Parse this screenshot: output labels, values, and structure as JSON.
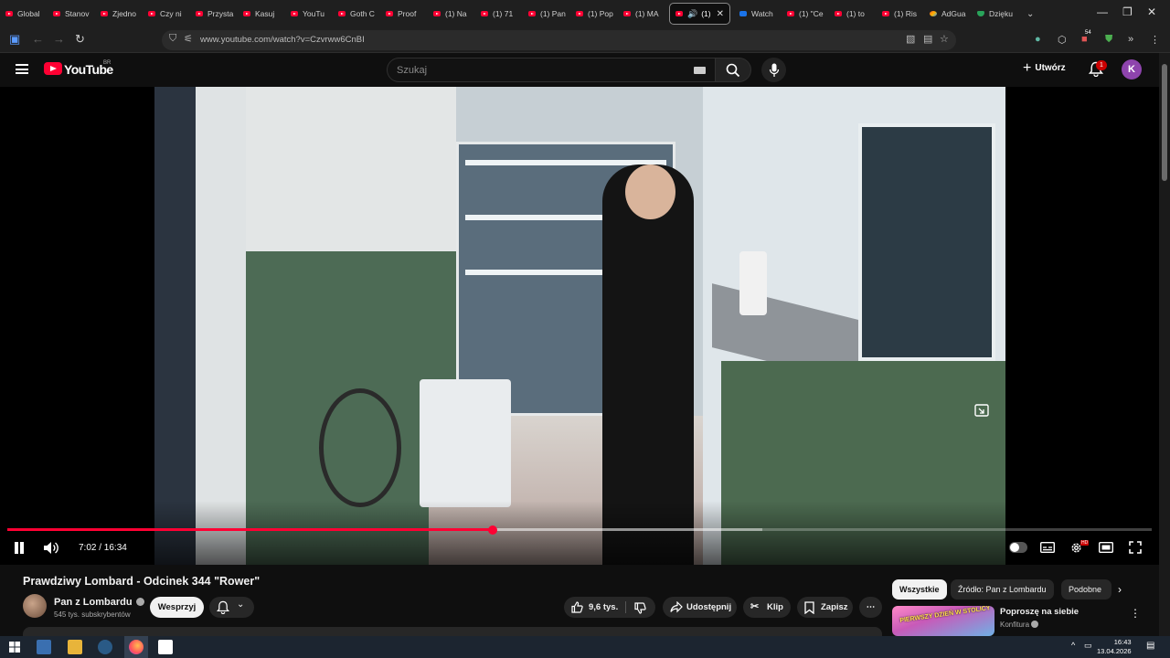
{
  "browser": {
    "tabs": [
      {
        "label": "Global",
        "icon": "youtube-icon"
      },
      {
        "label": "Stanov",
        "icon": "youtube-icon"
      },
      {
        "label": "Zjedno",
        "icon": "youtube-icon"
      },
      {
        "label": "Czy ni",
        "icon": "youtube-icon"
      },
      {
        "label": "Przysta",
        "icon": "youtube-icon"
      },
      {
        "label": "Kasuj",
        "icon": "youtube-icon"
      },
      {
        "label": "YouTu",
        "icon": "youtube-icon"
      },
      {
        "label": "Goth C",
        "icon": "youtube-icon"
      },
      {
        "label": "Proof",
        "icon": "youtube-icon"
      },
      {
        "label": "(1) Na",
        "icon": "youtube-icon"
      },
      {
        "label": "(1) 71",
        "icon": "youtube-icon"
      },
      {
        "label": "(1) Pan",
        "icon": "youtube-icon"
      },
      {
        "label": "(1) Pop",
        "icon": "youtube-icon"
      },
      {
        "label": "(1) MA",
        "icon": "youtube-icon"
      }
    ],
    "active_tab": {
      "label": "(1)"
    },
    "tabs_after": [
      {
        "label": "Watch",
        "icon": "blue-icon"
      },
      {
        "label": "(1) \"Ce",
        "icon": "youtube-icon"
      },
      {
        "label": "(1) to",
        "icon": "youtube-icon"
      },
      {
        "label": "(1) Ris",
        "icon": "youtube-icon"
      },
      {
        "label": "AdGua",
        "icon": "multi-icon"
      },
      {
        "label": "Dzięku",
        "icon": "green-icon"
      }
    ],
    "url": "www.youtube.com/watch?v=Czvrww6CnBI",
    "extension_badge": "54"
  },
  "youtube": {
    "wordmark": "YouTube",
    "country_code": "BR",
    "search_placeholder": "Szukaj",
    "create_label": "Utwórz",
    "notification_count": "1",
    "avatar_letter": "K"
  },
  "player": {
    "current_time": "7:02",
    "duration": "16:34",
    "time_display": "7:02 / 16:34",
    "progress_fraction": 0.424,
    "buffered_fraction": 0.66,
    "hd_badge": "HD"
  },
  "video": {
    "title": "Prawdziwy Lombard - Odcinek 344 \"Rower\"",
    "channel_name": "Pan z Lombardu",
    "subscribers": "545 tys. subskrybentów",
    "support_label": "Wesprzyj",
    "like_count": "9,6 tys.",
    "share_label": "Udostępnij",
    "clip_label": "Klip",
    "save_label": "Zapisz"
  },
  "sidebar": {
    "chips": [
      "Wszystkie",
      "Źródło: Pan z Lombardu",
      "Podobne"
    ],
    "recommendation": {
      "title": "Poproszę na siebie",
      "channel": "Konfitura",
      "thumbnail_text": "PIERWSZY DZIEŃ W STOLICY"
    }
  },
  "taskbar": {
    "time": "16:43",
    "date": "13.04.2026"
  }
}
